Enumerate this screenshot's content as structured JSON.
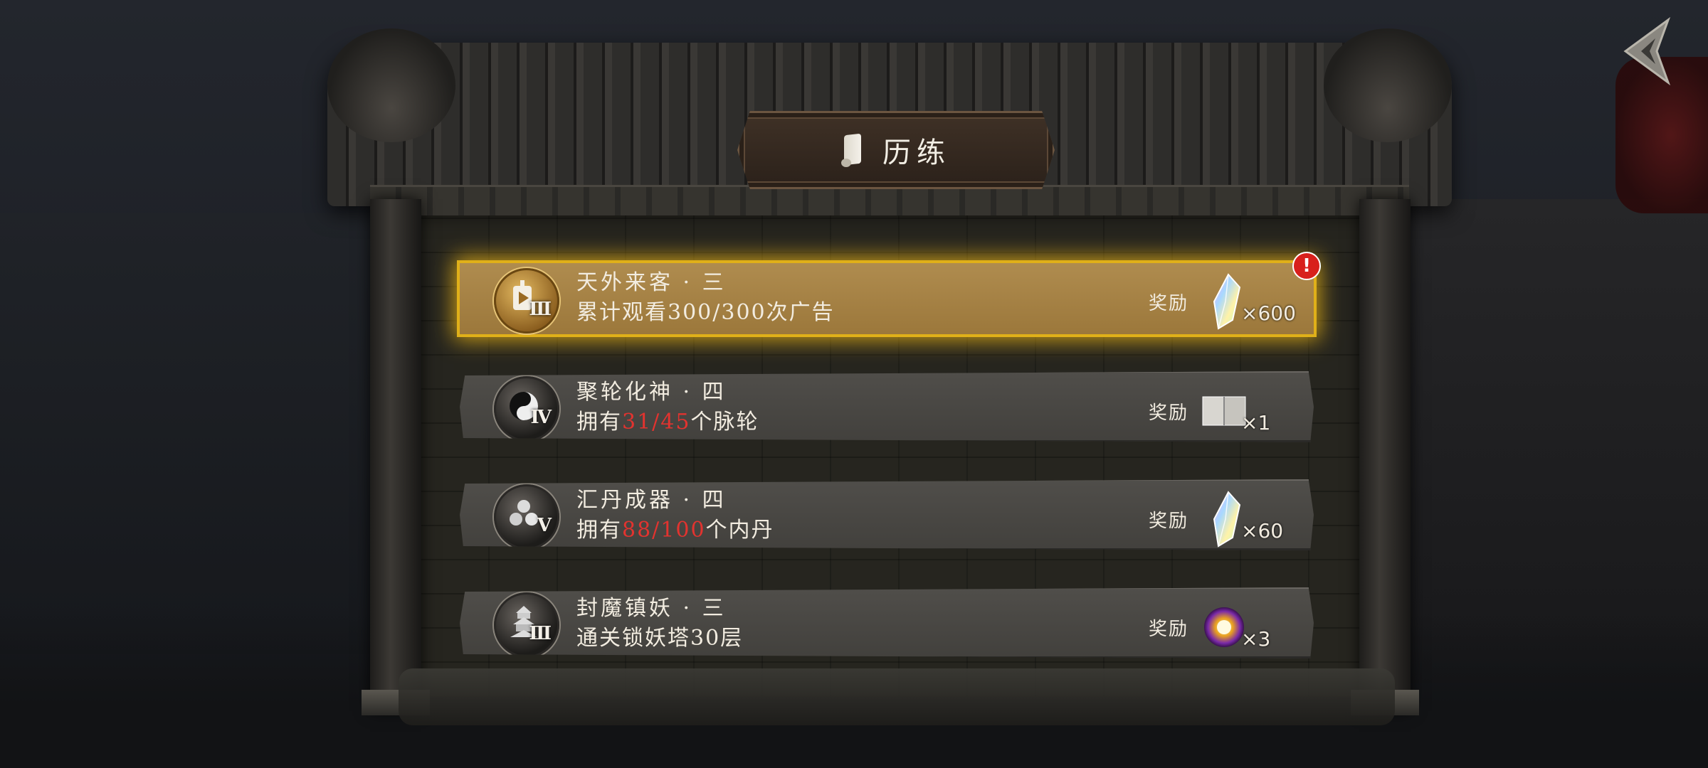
{
  "window": {
    "title": "历练"
  },
  "colors": {
    "active_gold": "#e0b019",
    "progress_red": "#e2332f",
    "card_gray": "#4a4844",
    "alert_red": "#d8201c"
  },
  "tasks": [
    {
      "title": "天外来客 · 三",
      "desc_before": "累计观看",
      "desc_highlight": "300/300",
      "desc_after": "次广告",
      "badge_roman": "Ⅲ",
      "badge_icon": "play-icon",
      "reward_label": "奖励",
      "reward_icon": "crystal-icon",
      "reward_count": "×600",
      "active": true,
      "alert": "!",
      "progress": {
        "current": 300,
        "total": 300
      }
    },
    {
      "title": "聚轮化神 · 四",
      "desc_before": "拥有",
      "desc_highlight": "31/45",
      "desc_after": "个脉轮",
      "badge_roman": "Ⅳ",
      "badge_icon": "yin-yang-icon",
      "reward_label": "奖励",
      "reward_icon": "book-icon",
      "reward_count": "×1",
      "active": false,
      "progress": {
        "current": 31,
        "total": 45
      }
    },
    {
      "title": "汇丹成器 · 四",
      "desc_before": "拥有",
      "desc_highlight": "88/100",
      "desc_after": "个内丹",
      "badge_roman": "Ⅴ",
      "badge_icon": "pill-orbs-icon",
      "reward_label": "奖励",
      "reward_icon": "crystal-icon",
      "reward_count": "×60",
      "active": false,
      "progress": {
        "current": 88,
        "total": 100
      }
    },
    {
      "title": "封魔镇妖 · 三",
      "desc_before": "通关锁妖塔30层",
      "desc_highlight": "",
      "desc_after": "",
      "badge_roman": "Ⅲ",
      "badge_icon": "pagoda-icon",
      "reward_label": "奖励",
      "reward_icon": "orb-icon",
      "reward_count": "×3",
      "active": false
    }
  ]
}
